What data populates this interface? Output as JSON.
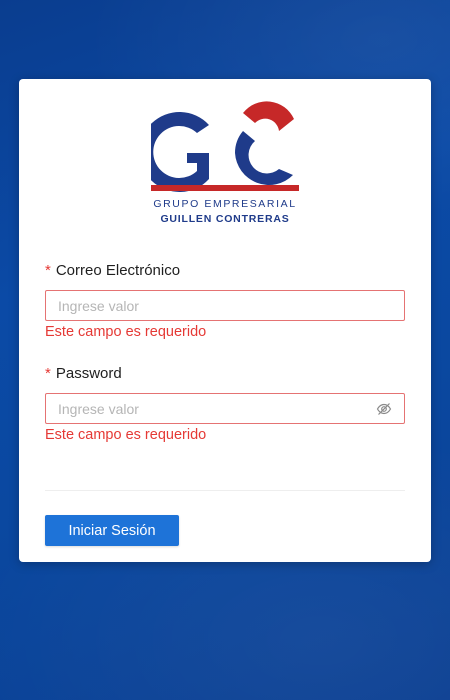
{
  "logo": {
    "monogram": "GC",
    "line1": "GRUPO EMPRESARIAL",
    "line2": "GUILLEN CONTRERAS",
    "colors": {
      "blue": "#1f3b8a",
      "red": "#c62828"
    }
  },
  "form": {
    "email": {
      "label": "Correo Electrónico",
      "required_mark": "*",
      "placeholder": "Ingrese valor",
      "value": "",
      "error": "Este campo es requerido"
    },
    "password": {
      "label": "Password",
      "required_mark": "*",
      "placeholder": "Ingrese valor",
      "value": "",
      "error": "Este campo es requerido",
      "toggle_icon": "eye-off-icon"
    },
    "submit_label": "Iniciar Sesión"
  },
  "colors": {
    "background": "#0b4aa6",
    "error": "#e53935",
    "primary": "#1e73d8"
  }
}
